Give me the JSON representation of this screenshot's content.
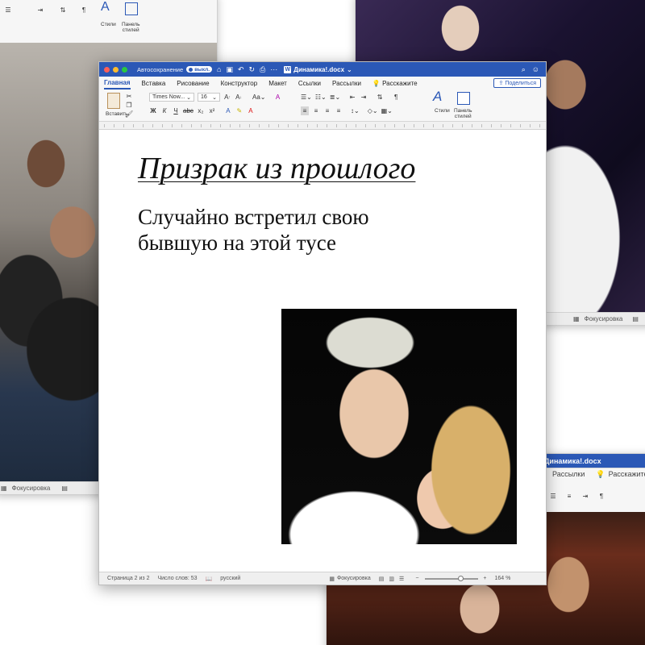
{
  "main_window": {
    "autosave_label": "Автосохранение",
    "autosave_state": "выкл.",
    "document_title": "Динамика!.docx",
    "tabs": [
      {
        "label": "Главная"
      },
      {
        "label": "Вставка"
      },
      {
        "label": "Рисование"
      },
      {
        "label": "Конструктор"
      },
      {
        "label": "Макет"
      },
      {
        "label": "Ссылки"
      },
      {
        "label": "Рассылки"
      },
      {
        "label": "Расскажите"
      }
    ],
    "share_label": "Поделиться",
    "ribbon": {
      "paste_label": "Вставить",
      "font_name": "Times Now...",
      "font_size": "16",
      "styles_label": "Стили",
      "styles_pane_label_1": "Панель",
      "styles_pane_label_2": "стилей"
    },
    "document": {
      "title": "Призрак из прошлого",
      "body_line_1": "Случайно встретил свою",
      "body_line_2": "бывшую на этой тусе"
    },
    "status": {
      "page": "Страница 2 из 2",
      "words": "Число слов: 53",
      "language": "русский",
      "focus": "Фокусировка",
      "zoom": "164 %",
      "zoom_level": 0.62
    },
    "accent_color": "#2b58b6"
  },
  "bg_window_top_left": {
    "styles_label": "Стили",
    "styles_pane_label_1": "Панель",
    "styles_pane_label_2": "стилей",
    "status_focus": "Фокусировка"
  },
  "bg_window_top_right": {
    "status_focus": "Фокусировка"
  },
  "bg_window_bottom_right": {
    "document_title": "Динамика!.docx",
    "tabs": [
      {
        "label": "Рассылки"
      },
      {
        "label": "Расскажите"
      }
    ]
  }
}
